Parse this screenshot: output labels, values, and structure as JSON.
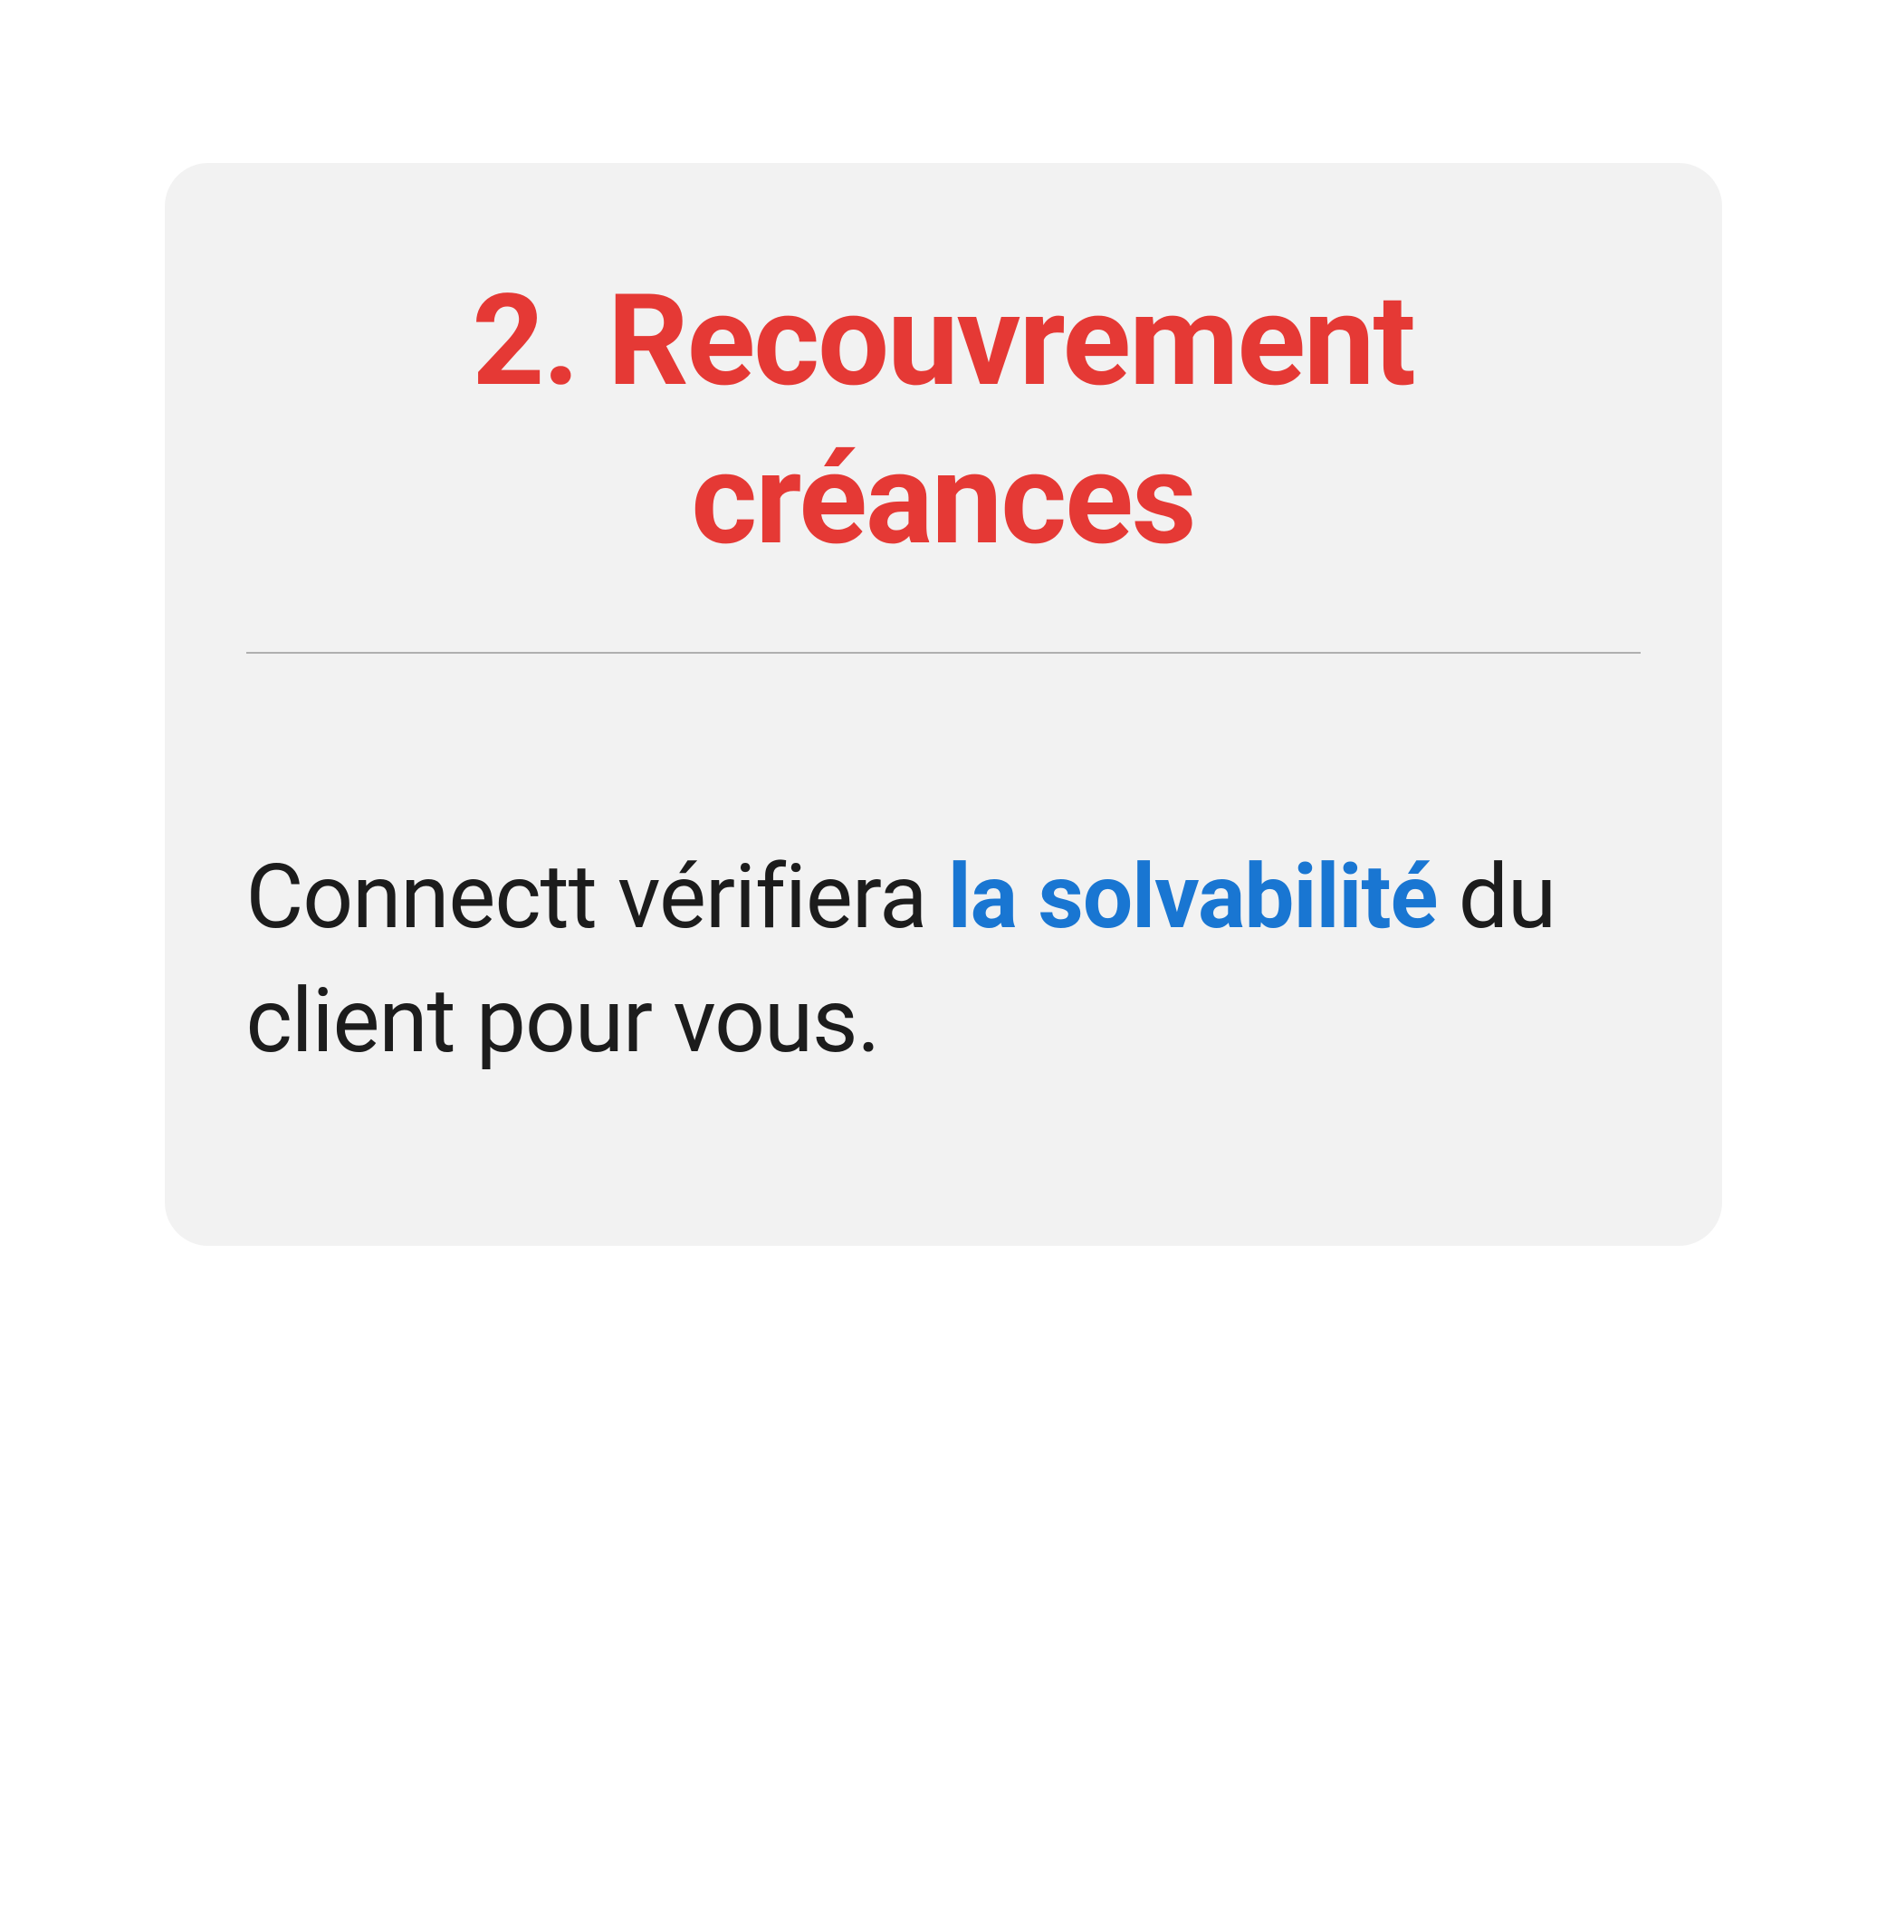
{
  "card": {
    "title": "2. Recouvrement créances",
    "body": {
      "before": "Connectt vérifiera ",
      "highlight": "la solvabilité",
      "after": " du client pour vous."
    }
  }
}
